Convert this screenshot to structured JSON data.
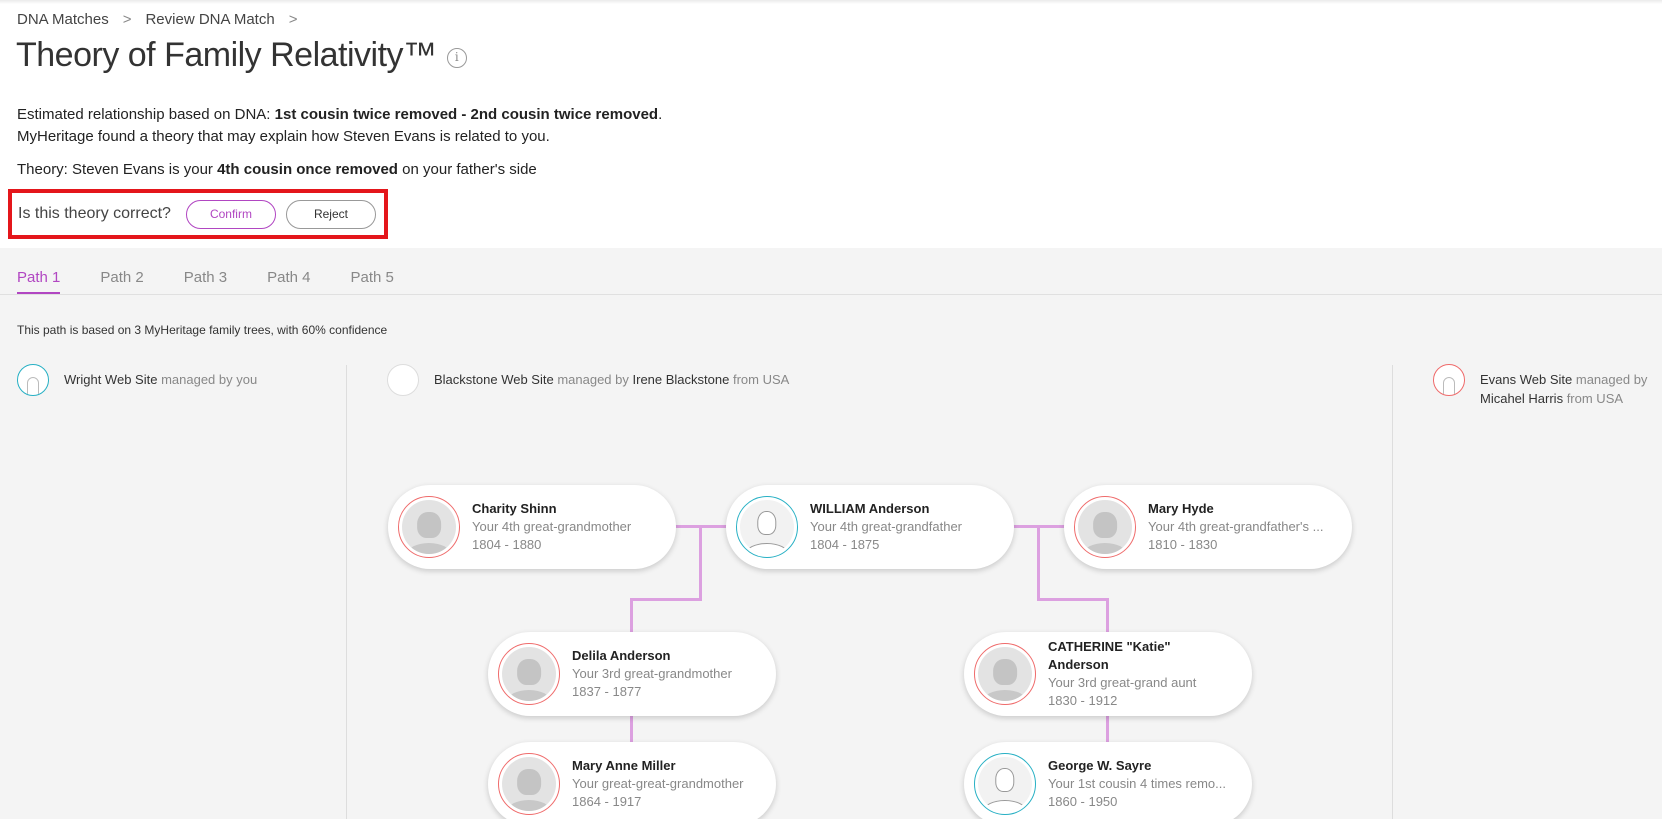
{
  "breadcrumb": {
    "item1": "DNA Matches",
    "item2": "Review DNA Match",
    "sep": ">"
  },
  "title": "Theory of Family Relativity™",
  "estimate": {
    "prefix": "Estimated relationship based on DNA: ",
    "value": "1st cousin twice removed - 2nd cousin twice removed",
    "suffix": ".",
    "line2": "MyHeritage found a theory that may explain how Steven Evans is related to you."
  },
  "theory": {
    "prefix": "Theory: Steven Evans is your ",
    "value": "4th cousin once removed",
    "suffix": " on your father's side"
  },
  "confirm": {
    "question": "Is this theory correct?",
    "confirm_label": "Confirm",
    "reject_label": "Reject"
  },
  "tabs": [
    "Path 1",
    "Path 2",
    "Path 3",
    "Path 4",
    "Path 5"
  ],
  "path_note": "This path is based on 3 MyHeritage family trees, with 60% confidence",
  "sites": {
    "left": {
      "name": "Wright Web Site",
      "managed": " managed by you"
    },
    "middle": {
      "name": "Blackstone Web Site",
      "managed": " managed by ",
      "owner": "Irene Blackstone",
      "from": " from USA"
    },
    "right": {
      "name": "Evans Web Site",
      "managed": " managed by",
      "owner": "Micahel Harris",
      "from": " from USA"
    }
  },
  "people": [
    {
      "name": "Charity Shinn",
      "relation": "Your 4th great-grandmother",
      "years": "1804 - 1880"
    },
    {
      "name": "WILLIAM Anderson",
      "relation": "Your 4th great-grandfather",
      "years": "1804 - 1875"
    },
    {
      "name": "Mary Hyde",
      "relation": "Your 4th great-grandfather's ...",
      "years": "1810 - 1830"
    },
    {
      "name": "Delila Anderson",
      "relation": "Your 3rd great-grandmother",
      "years": "1837 - 1877"
    },
    {
      "name": "CATHERINE \"Katie\" Anderson",
      "relation": "Your 3rd great-grand aunt",
      "years": "1830 - 1912"
    },
    {
      "name": "Mary Anne Miller",
      "relation": "Your great-great-grandmother",
      "years": "1864 - 1917"
    },
    {
      "name": "George W. Sayre",
      "relation": "Your 1st cousin 4 times remo...",
      "years": "1860 - 1950"
    }
  ],
  "colors": {
    "accent": "#b146c2",
    "highlight": "#e4161b",
    "connector": "#dca0e0",
    "female_ring": "#ef6b6b",
    "male_ring": "#27b0c4"
  }
}
